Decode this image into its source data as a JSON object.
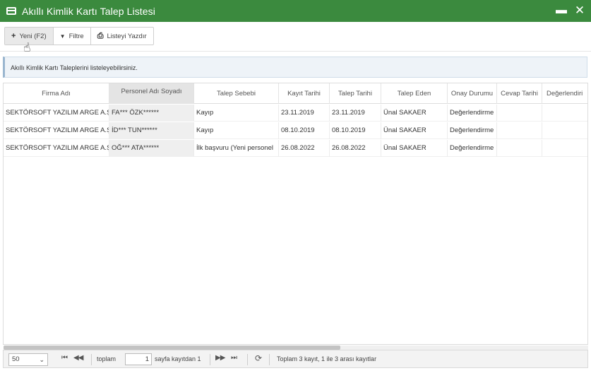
{
  "window": {
    "title": "Akıllı Kimlik Kartı Talep Listesi",
    "minimize_label": "▬",
    "close_label": "✕"
  },
  "toolbar": {
    "buttons": [
      {
        "icon": "plus-icon",
        "glyph": "+",
        "label": "Yeni (F2)"
      },
      {
        "icon": "filter-icon",
        "glyph": "▼",
        "label": "Filtre"
      },
      {
        "icon": "print-icon",
        "glyph": "⎙",
        "label": "Listeyi Yazdır"
      }
    ]
  },
  "info": {
    "text": "Akıllı Kimlik Kartı Taleplerini listeleyebilirsiniz."
  },
  "grid": {
    "columns": [
      "Firma Adı",
      "Personel Adı Soyadı",
      "Talep Sebebi",
      "Kayıt Tarihi",
      "Talep Tarihi",
      "Talep Eden",
      "Onay Durumu",
      "Cevap Tarihi",
      "Değerlendiri"
    ],
    "rows": [
      [
        "SEKTÖRSOFT YAZILIM ARGE A.Ş",
        "FA*** ÖZK******",
        "Kayıp",
        "23.11.2019",
        "23.11.2019",
        "Ünal SAKAER",
        "Değerlendirme",
        "",
        ""
      ],
      [
        "SEKTÖRSOFT YAZILIM ARGE A.Ş",
        "İD*** TUN******",
        "Kayıp",
        "08.10.2019",
        "08.10.2019",
        "Ünal SAKAER",
        "Değerlendirme",
        "",
        ""
      ],
      [
        "SEKTÖRSOFT YAZILIM ARGE A.Ş",
        "OĞ*** ATA******",
        "İlk başvuru (Yeni personel",
        "26.08.2022",
        "26.08.2022",
        "Ünal SAKAER",
        "Değerlendirme",
        "",
        ""
      ]
    ]
  },
  "pager": {
    "page_size": "50",
    "first_glyph": "⏮",
    "prev_glyph": "◀◀",
    "total_label": "toplam",
    "page_value": "1",
    "page_suffix": "sayfa kayıtdan 1",
    "next_glyph": "▶▶",
    "last_glyph": "⏭",
    "refresh_glyph": "⟳",
    "summary": "Toplam 3 kayıt, 1 ile 3 arası kayıtlar"
  },
  "colors": {
    "titlebar": "#3b8a3e",
    "info_bg": "#eef3f8"
  }
}
